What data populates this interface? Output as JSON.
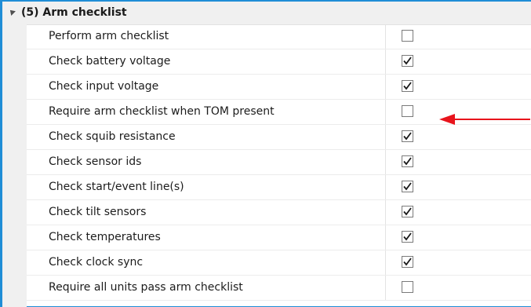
{
  "category": {
    "title": "(5) Arm checklist",
    "icon": "collapse-triangle-icon"
  },
  "rows": [
    {
      "label": "Perform arm checklist",
      "checked": false
    },
    {
      "label": "Check battery voltage",
      "checked": true
    },
    {
      "label": "Check input voltage",
      "checked": true
    },
    {
      "label": "Require arm checklist when TOM present",
      "checked": false
    },
    {
      "label": "Check squib resistance",
      "checked": true
    },
    {
      "label": "Check sensor ids",
      "checked": true
    },
    {
      "label": "Check start/event line(s)",
      "checked": true
    },
    {
      "label": "Check tilt sensors",
      "checked": true
    },
    {
      "label": "Check temperatures",
      "checked": true
    },
    {
      "label": "Check clock sync",
      "checked": true
    },
    {
      "label": "Require all units pass arm checklist",
      "checked": false
    }
  ],
  "annotation": {
    "icon": "red-arrow-icon",
    "color": "#e8141c"
  },
  "colors": {
    "accent": "#1f8dd6",
    "category_background": "#f0f0f0"
  }
}
